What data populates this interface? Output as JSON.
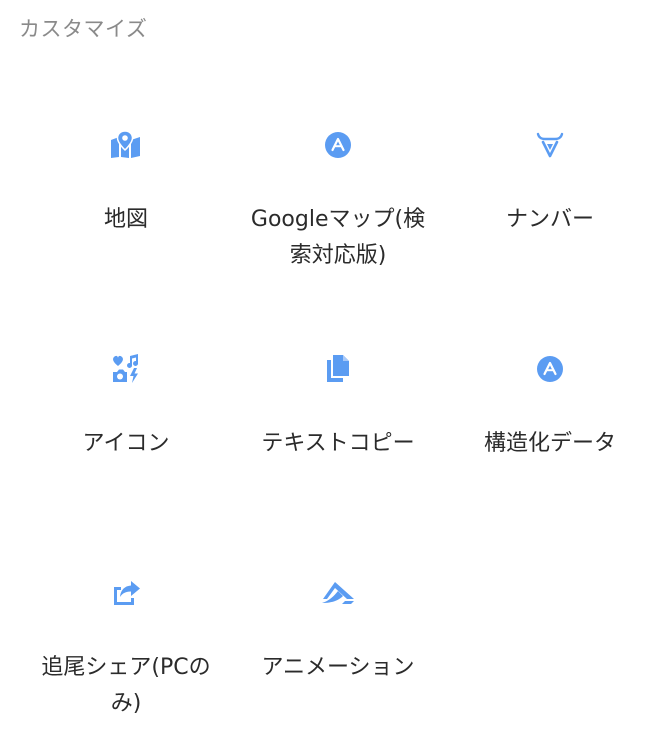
{
  "section": {
    "title": "カスタマイズ"
  },
  "colors": {
    "accent": "#5b9cf2",
    "title": "#8a8a8a",
    "label": "#2b2b2b"
  },
  "tiles": [
    {
      "label": "地図",
      "icon": "map-marker-icon"
    },
    {
      "label": "Googleマップ(検索対応版)",
      "icon": "circle-a-icon"
    },
    {
      "label": "ナンバー",
      "icon": "bull-head-icon"
    },
    {
      "label": "アイコン",
      "icon": "icons-collage-icon"
    },
    {
      "label": "テキストコピー",
      "icon": "copy-document-icon"
    },
    {
      "label": "構造化データ",
      "icon": "circle-a-icon"
    },
    {
      "label": "追尾シェア(PCのみ)",
      "icon": "share-arrow-icon"
    },
    {
      "label": "アニメーション",
      "icon": "animation-wing-icon"
    }
  ]
}
